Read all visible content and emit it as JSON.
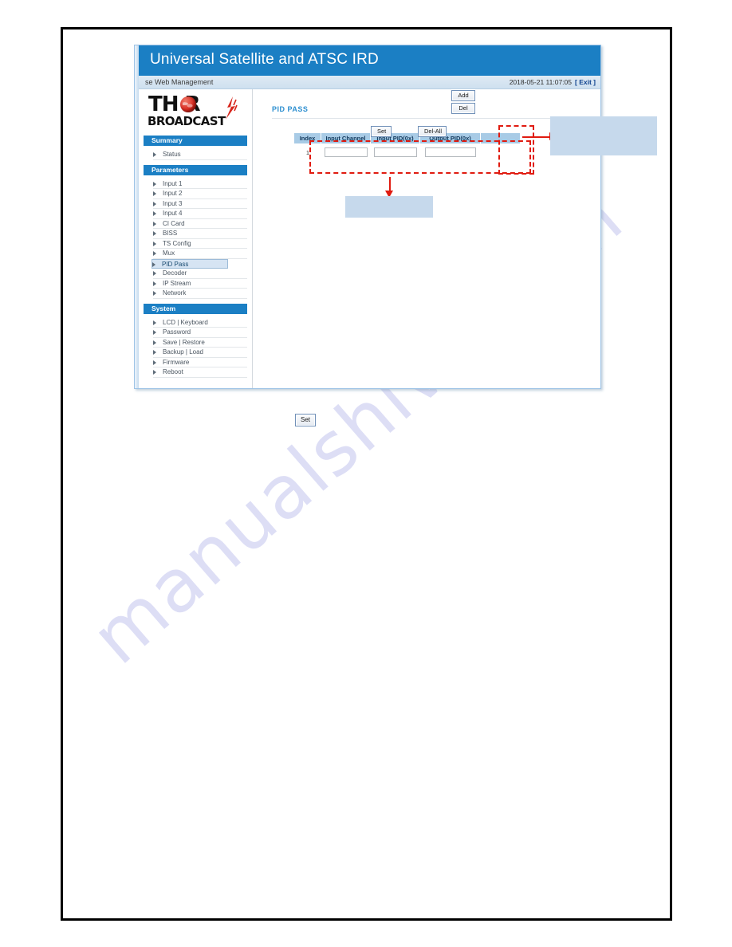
{
  "window": {
    "app_title": "Universal Satellite and ATSC IRD",
    "sub_header_left": "se Web Management",
    "timestamp": "2018-05-21 11:07:05",
    "exit_label": "[ Exit ]"
  },
  "logo": {
    "brand_top": "TH   R",
    "brand_bottom": "BROADCAST",
    "globe_icon": "globe-icon",
    "bolt_icon": "lightning-bolt-icon"
  },
  "sidebar": {
    "sections": [
      {
        "header": "Summary",
        "items": [
          {
            "label": "Status",
            "selected": false
          }
        ]
      },
      {
        "header": "Parameters",
        "items": [
          {
            "label": "Input 1",
            "selected": false
          },
          {
            "label": "Input 2",
            "selected": false
          },
          {
            "label": "Input 3",
            "selected": false
          },
          {
            "label": "Input 4",
            "selected": false
          },
          {
            "label": "CI Card",
            "selected": false
          },
          {
            "label": "BISS",
            "selected": false
          },
          {
            "label": "TS Config",
            "selected": false
          },
          {
            "label": "Mux",
            "selected": false
          },
          {
            "label": "PID Pass",
            "selected": true
          },
          {
            "label": "Decoder",
            "selected": false
          },
          {
            "label": "IP Stream",
            "selected": false
          },
          {
            "label": "Network",
            "selected": false
          }
        ]
      },
      {
        "header": "System",
        "items": [
          {
            "label": "LCD | Keyboard",
            "selected": false
          },
          {
            "label": "Password",
            "selected": false
          },
          {
            "label": "Save | Restore",
            "selected": false
          },
          {
            "label": "Backup | Load",
            "selected": false
          },
          {
            "label": "Firmware",
            "selected": false
          },
          {
            "label": "Reboot",
            "selected": false
          }
        ]
      }
    ]
  },
  "content": {
    "page_title": "PID PASS",
    "table": {
      "columns": [
        "Index",
        "Input Channel",
        "Input PID(0x)",
        "Output PID(0x)",
        ""
      ],
      "rows": [
        {
          "index": "1",
          "input_channel": "",
          "input_pid": "",
          "output_pid": ""
        }
      ]
    },
    "buttons": {
      "add": "Add",
      "del": "Del",
      "set": "Set",
      "del_all": "Del-All"
    }
  },
  "annotations": {
    "callout_right_text": "",
    "callout_bottom_text": ""
  },
  "footer": {
    "set_button": "Set"
  },
  "watermark": {
    "text": "manualshive.com"
  },
  "colors": {
    "brand_blue": "#1b7fc4",
    "title_blue": "#2d8fd0",
    "table_header_blue": "#a8cbe6",
    "callout_blue": "#c6d9ec",
    "annotation_red": "#e01b10",
    "selected_nav": "#d6e4f3",
    "watermark": "#c9cbf0"
  }
}
